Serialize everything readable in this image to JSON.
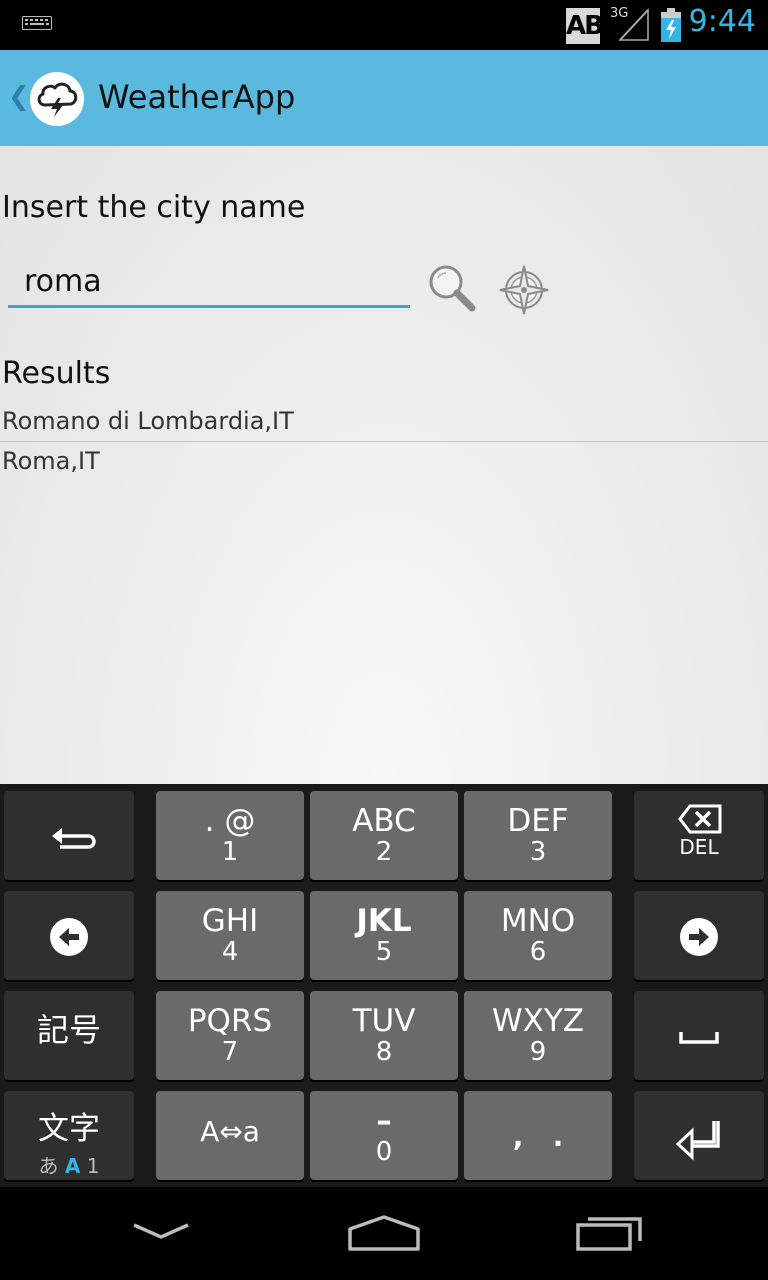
{
  "status_bar": {
    "indicator": "AB",
    "network": "3G",
    "time": "9:44",
    "icons": [
      "keyboard-icon",
      "signal-icon",
      "battery-charging-icon"
    ]
  },
  "action_bar": {
    "title": "WeatherApp",
    "icon": "cloud-lightning-icon"
  },
  "search": {
    "label": "Insert the city name",
    "value": "roma",
    "search_icon": "magnifier-icon",
    "locate_icon": "locate-icon"
  },
  "results": {
    "label": "Results",
    "items": [
      "Romano di Lombardia,IT",
      "Roma,IT"
    ]
  },
  "keyboard": {
    "row1": [
      {
        "top": ". @",
        "bottom": "1"
      },
      {
        "top": "ABC",
        "bottom": "2"
      },
      {
        "top": "DEF",
        "bottom": "3"
      }
    ],
    "row2": [
      {
        "top": "GHI",
        "bottom": "4"
      },
      {
        "top": "JKL",
        "bottom": "5"
      },
      {
        "top": "MNO",
        "bottom": "6"
      }
    ],
    "row3": [
      {
        "top": "PQRS",
        "bottom": "7"
      },
      {
        "top": "TUV",
        "bottom": "8"
      },
      {
        "top": "WXYZ",
        "bottom": "9"
      }
    ],
    "row4": [
      {
        "top": "A⇔a",
        "bottom": ""
      },
      {
        "top": "–",
        "bottom": "0"
      },
      {
        "top": ",   .",
        "bottom": ""
      }
    ],
    "del_label": "DEL",
    "symbols_label": "記号",
    "mode_label": "文字",
    "mode_sub": [
      "あ",
      "A",
      "1"
    ],
    "accent": "#33b5e5"
  },
  "colors": {
    "action_bar": "#5ab9df",
    "accent": "#33b5e5",
    "input_underline": "#33a8d6"
  }
}
